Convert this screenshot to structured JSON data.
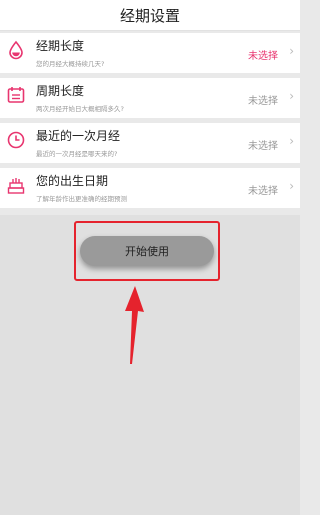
{
  "header": {
    "title": "经期设置"
  },
  "items": [
    {
      "label": "经期长度",
      "sub": "您的月经大概持续几天?",
      "status": "未选择",
      "status_color": "#e8356f",
      "icon": "drop-icon"
    },
    {
      "label": "周期长度",
      "sub": "两次月经开始日大概相隔多久?",
      "status": "未选择",
      "status_color": "#999999",
      "icon": "calendar-icon"
    },
    {
      "label": "最近的一次月经",
      "sub": "最近的一次月经是哪天来的?",
      "status": "未选择",
      "status_color": "#999999",
      "icon": "clock-icon"
    },
    {
      "label": "您的出生日期",
      "sub": "了解年龄作出更准确的经期预测",
      "status": "未选择",
      "status_color": "#999999",
      "icon": "cake-icon"
    }
  ],
  "start_button": {
    "label": "开始使用"
  },
  "colors": {
    "accent": "#e8356f",
    "highlight": "#e5232d"
  }
}
